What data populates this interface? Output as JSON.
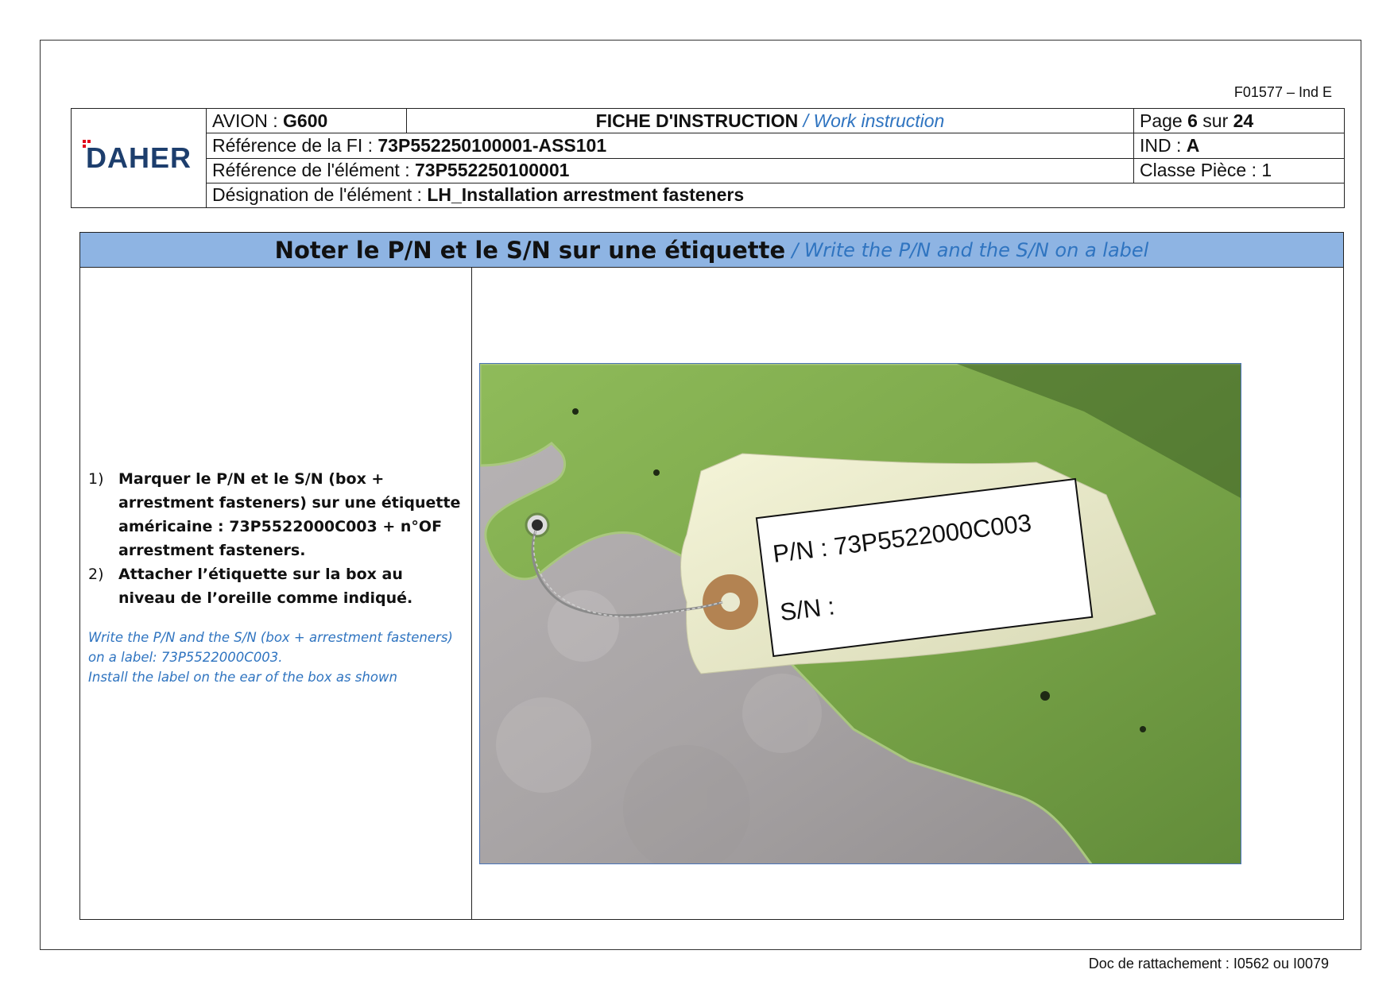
{
  "form_code": "F01577 – Ind E",
  "logo_text": "DAHER",
  "header": {
    "avion_label": "AVION : ",
    "avion_value": "G600",
    "title_fr": "FICHE D'INSTRUCTION",
    "title_en": " / Work instruction",
    "page_prefix": "Page ",
    "page_current": "6",
    "page_sur": " sur ",
    "page_total": "24",
    "ref_fi_label": "Référence de la FI : ",
    "ref_fi_value": "73P552250100001-ASS101",
    "ind_label": "IND : ",
    "ind_value": "A",
    "ref_elem_label": "Référence de l'élément : ",
    "ref_elem_value": "73P552250100001",
    "classe_label": "Classe Pièce : 1",
    "designation_label": "Désignation de l'élément : ",
    "designation_value": "LH_Installation arrestment fasteners"
  },
  "section": {
    "title_fr": "Noter le P/N et le S/N sur une étiquette",
    "title_en": "/ Write the P/N and the S/N on a label",
    "steps": [
      {
        "num": "1)",
        "text": "Marquer le P/N et le S/N (box + arrestment fasteners) sur une étiquette américaine : 73P5522000C003 + n°OF arrestment fasteners."
      },
      {
        "num": "2)",
        "text": "Attacher l’étiquette sur la box au niveau de l’oreille comme indiqué."
      }
    ],
    "note_lines": [
      "Write the P/N and the S/N (box + arrestment fasteners)",
      "on a label: 73P5522000C003.",
      "Install the label on the ear of the box as shown"
    ]
  },
  "photo": {
    "label_pn": "P/N : 73P5522000C003",
    "label_sn": "S/N :"
  },
  "footer": "Doc de rattachement : I0562 ou I0079"
}
